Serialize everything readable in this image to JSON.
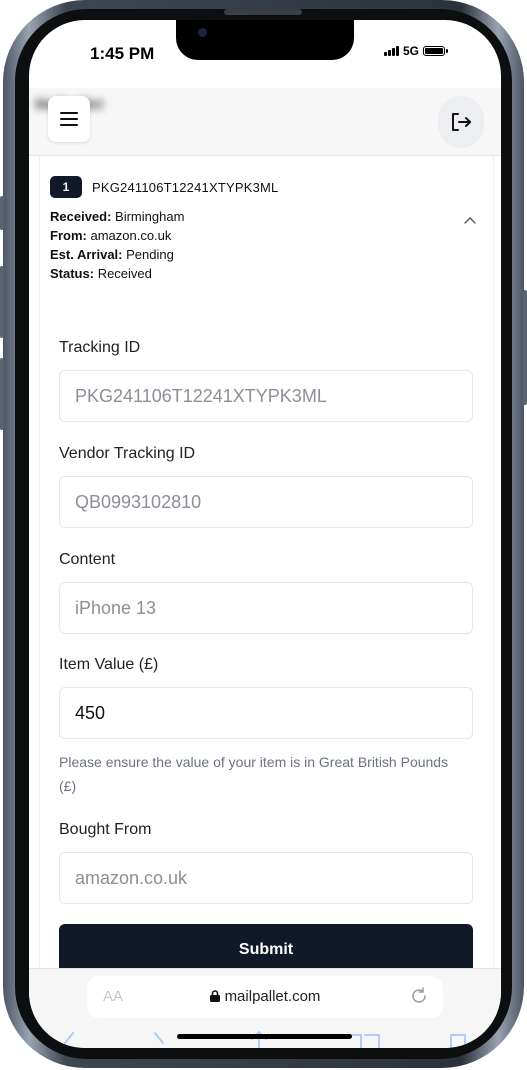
{
  "status_bar": {
    "time": "1:45 PM",
    "network": "5G"
  },
  "header": {
    "brand": "Mailpallet",
    "menu_icon": "hamburger-icon",
    "logout_icon": "logout-icon"
  },
  "package": {
    "index": "1",
    "tracking_id": "PKG241106T12241XTYPK3ML",
    "received_label": "Received:",
    "received_value": "Birmingham",
    "from_label": "From:",
    "from_value": "amazon.co.uk",
    "arrival_label": "Est. Arrival:",
    "arrival_value": "Pending",
    "status_label": "Status:",
    "status_value": "Received"
  },
  "form": {
    "tracking_label": "Tracking ID",
    "tracking_value": "PKG241106T12241XTYPK3ML",
    "vendor_label": "Vendor Tracking ID",
    "vendor_value": "QB0993102810",
    "content_label": "Content",
    "content_value": "iPhone 13",
    "value_label": "Item Value (£)",
    "value_value": "450",
    "value_hint": "Please ensure the value of your item is in Great British Pounds (£)",
    "bought_label": "Bought From",
    "bought_value": "amazon.co.uk",
    "submit_label": "Submit"
  },
  "browser": {
    "text_size_label": "AA",
    "url": "mailpallet.com"
  },
  "colors": {
    "primary_dark": "#111827",
    "header_bg": "#f7f7f8"
  }
}
